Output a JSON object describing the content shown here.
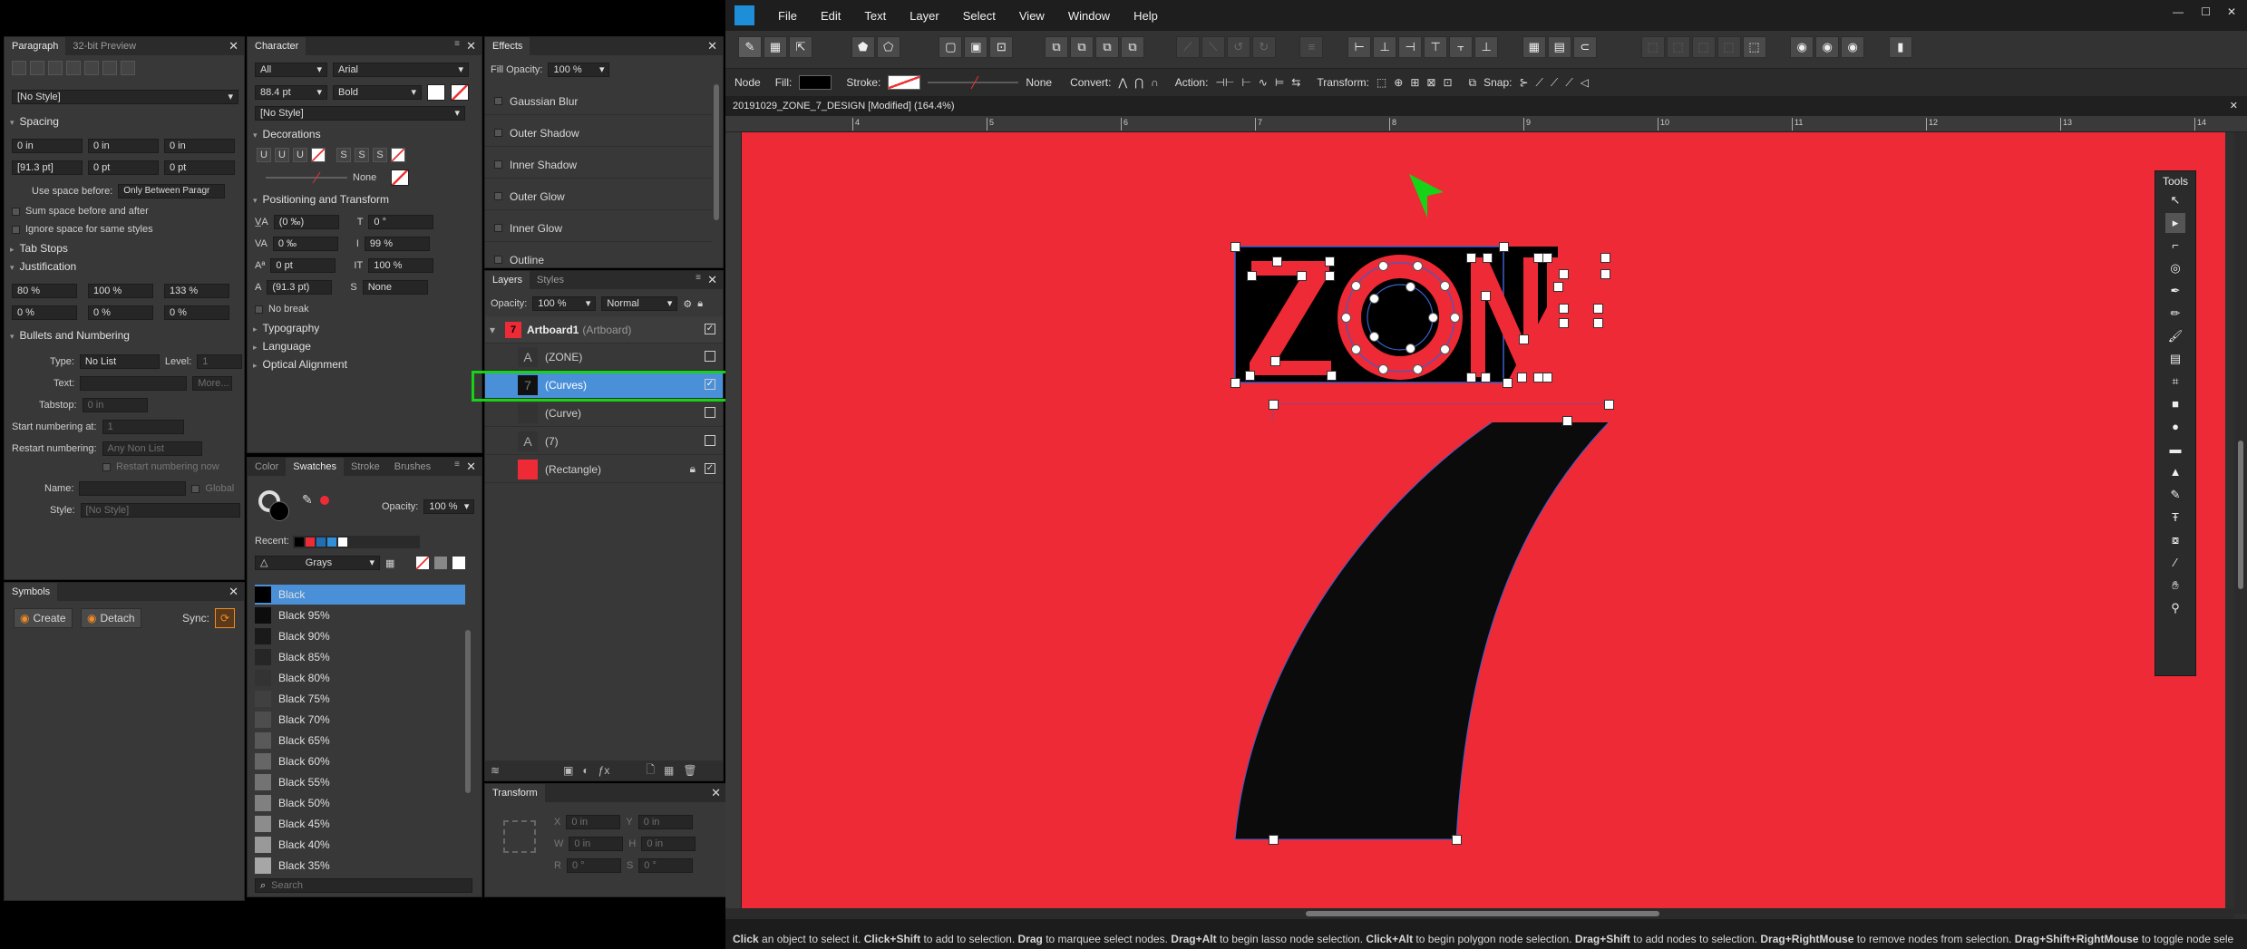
{
  "paragraph": {
    "tabs": [
      "Paragraph",
      "32-bit Preview"
    ],
    "style_none": "[No Style]",
    "spacing_title": "Spacing",
    "indent_left": "0 in",
    "indent_first": "0 in",
    "indent_right": "0 in",
    "leading": "[91.3 pt]",
    "space_before": "0 pt",
    "space_after": "0 pt",
    "use_space_before_label": "Use space before:",
    "use_space_before_value": "Only Between Paragr",
    "sum_space": "Sum space before and after",
    "ignore_space": "Ignore space for same styles",
    "tab_stops": "Tab Stops",
    "justification": "Justification",
    "just_values": [
      "80 %",
      "100 %",
      "133 %",
      "0 %",
      "0 %",
      "0 %"
    ],
    "bullets": "Bullets and Numbering",
    "type_label": "Type:",
    "type_value": "No List",
    "level_label": "Level:",
    "level_value": "1",
    "text_label": "Text:",
    "more": "More...",
    "tabstop_label": "Tabstop:",
    "tabstop_value": "0 in",
    "start_num_label": "Start numbering at:",
    "start_num_value": "1",
    "restart_label": "Restart numbering:",
    "restart_value": "Any Non List",
    "restart_now": "Restart numbering now",
    "name_label": "Name:",
    "global": "Global",
    "style_label": "Style:",
    "style_value": "[No Style]"
  },
  "symbols": {
    "title": "Symbols",
    "create": "Create",
    "detach": "Detach",
    "sync": "Sync:"
  },
  "character": {
    "title": "Character",
    "lang": "All",
    "font": "Arial",
    "size": "88.4 pt",
    "weight": "Bold",
    "style": "[No Style]",
    "decorations": "Decorations",
    "none": "None",
    "pos_transform": "Positioning and Transform",
    "kern": "(0 ‰)",
    "skew": "0 °",
    "track": "0 ‰",
    "vscale": "99 %",
    "baseline": "0 pt",
    "hscale": "100 %",
    "leading": "(91.3 pt)",
    "caps": "None",
    "no_break": "No break",
    "typography": "Typography",
    "language": "Language",
    "optical": "Optical Alignment"
  },
  "effects": {
    "title": "Effects",
    "fill_opacity_label": "Fill Opacity:",
    "fill_opacity": "100 %",
    "items": [
      "Gaussian Blur",
      "Outer Shadow",
      "Inner Shadow",
      "Outer Glow",
      "Inner Glow",
      "Outline"
    ]
  },
  "layers": {
    "tabs": [
      "Layers",
      "Styles"
    ],
    "opacity_label": "Opacity:",
    "opacity": "100 %",
    "blend": "Normal",
    "artboard": "Artboard1",
    "artboard_type": "(Artboard)",
    "items": [
      {
        "name": "(ZONE)",
        "icon": "A"
      },
      {
        "name": "(Curves)",
        "icon": "7"
      },
      {
        "name": "(Curve)",
        "icon": ""
      },
      {
        "name": "(7)",
        "icon": "A"
      },
      {
        "name": "(Rectangle)",
        "icon": ""
      }
    ]
  },
  "swatches": {
    "tabs": [
      "Color",
      "Swatches",
      "Stroke",
      "Brushes"
    ],
    "opacity_label": "Opacity:",
    "opacity": "100 %",
    "recent": "Recent:",
    "palette": "Grays",
    "items": [
      {
        "name": "Black",
        "color": "#000000"
      },
      {
        "name": "Black 95%",
        "color": "#0d0d0d"
      },
      {
        "name": "Black 90%",
        "color": "#1a1a1a"
      },
      {
        "name": "Black 85%",
        "color": "#262626"
      },
      {
        "name": "Black 80%",
        "color": "#333333"
      },
      {
        "name": "Black 75%",
        "color": "#404040"
      },
      {
        "name": "Black 70%",
        "color": "#4d4d4d"
      },
      {
        "name": "Black 65%",
        "color": "#595959"
      },
      {
        "name": "Black 60%",
        "color": "#666666"
      },
      {
        "name": "Black 55%",
        "color": "#737373"
      },
      {
        "name": "Black 50%",
        "color": "#808080"
      },
      {
        "name": "Black 45%",
        "color": "#8c8c8c"
      },
      {
        "name": "Black 40%",
        "color": "#999999"
      },
      {
        "name": "Black 35%",
        "color": "#a6a6a6"
      }
    ],
    "search": "Search"
  },
  "transform": {
    "title": "Transform",
    "x": "0 in",
    "y": "0 in",
    "w": "0 in",
    "h": "0 in",
    "r": "0 °",
    "s": "0 °"
  },
  "menu": [
    "File",
    "Edit",
    "Text",
    "Layer",
    "Select",
    "View",
    "Window",
    "Help"
  ],
  "context": {
    "node": "Node",
    "fill": "Fill:",
    "stroke": "Stroke:",
    "none": "None",
    "convert": "Convert:",
    "action": "Action:",
    "transform": "Transform:",
    "snap": "Snap:"
  },
  "doc_title": "20191029_ZONE_7_DESIGN [Modified] (164.4%)",
  "ruler": [
    "4",
    "5",
    "6",
    "7",
    "8",
    "9",
    "10",
    "11",
    "12",
    "13",
    "14"
  ],
  "canvas": {
    "word": "ZONE",
    "number": "7",
    "bg": "#ee2a36"
  },
  "tools_title": "Tools",
  "status": [
    {
      "b": "Click",
      "t": " an object to select it. "
    },
    {
      "b": "Click+Shift",
      "t": " to add to selection. "
    },
    {
      "b": "Drag",
      "t": " to marquee select nodes. "
    },
    {
      "b": "Drag+Alt",
      "t": " to begin lasso node selection. "
    },
    {
      "b": "Click+Alt",
      "t": " to begin polygon node selection. "
    },
    {
      "b": "Drag+Shift",
      "t": " to add nodes to selection. "
    },
    {
      "b": "Drag+RightMouse",
      "t": " to remove nodes from selection. "
    },
    {
      "b": "Drag+Shift+RightMouse",
      "t": " to toggle node sele"
    }
  ]
}
